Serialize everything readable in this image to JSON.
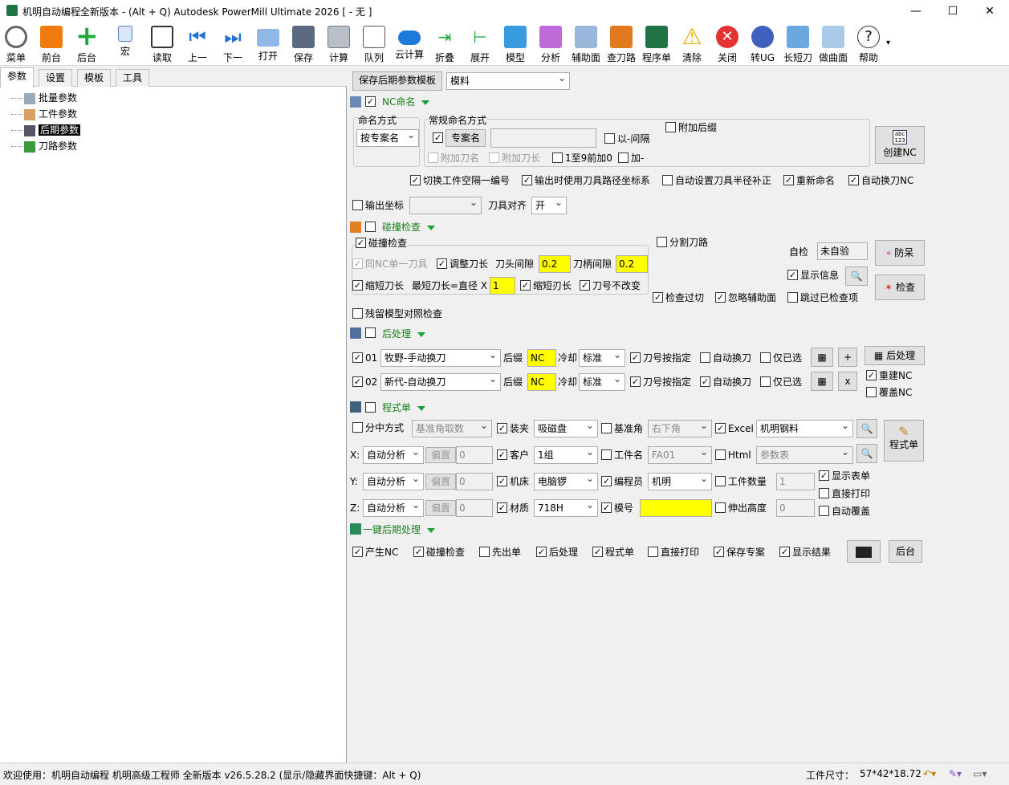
{
  "window": {
    "title": "机明自动编程全新版本 - (Alt + Q) Autodesk PowerMill Ultimate 2026    [ - 无 ]",
    "min": "—",
    "max": "☐",
    "close": "✕"
  },
  "toolbar": [
    {
      "label": "菜单",
      "icon": "gear-icon"
    },
    {
      "label": "前台",
      "icon": "powermill-icon"
    },
    {
      "label": "后台",
      "icon": "plus-icon"
    },
    {
      "label": "宏",
      "icon": "macro-icon"
    },
    {
      "label": "读取",
      "icon": "sliders-icon"
    },
    {
      "label": "上一",
      "icon": "skip-back-icon"
    },
    {
      "label": "下一",
      "icon": "skip-forward-icon"
    },
    {
      "label": "打开",
      "icon": "folder-icon"
    },
    {
      "label": "保存",
      "icon": "save-icon"
    },
    {
      "label": "计算",
      "icon": "calculator-icon"
    },
    {
      "label": "队列",
      "icon": "terminal-icon"
    },
    {
      "label": "云计算",
      "icon": "cloud-icon"
    },
    {
      "label": "折叠",
      "icon": "collapse-icon"
    },
    {
      "label": "展开",
      "icon": "expand-icon"
    },
    {
      "label": "模型",
      "icon": "cube-icon"
    },
    {
      "label": "分析",
      "icon": "analysis-icon"
    },
    {
      "label": "辅助面",
      "icon": "surface-icon"
    },
    {
      "label": "查刀路",
      "icon": "tools-icon"
    },
    {
      "label": "程序单",
      "icon": "excel-icon"
    },
    {
      "label": "清除",
      "icon": "warning-icon"
    },
    {
      "label": "关闭",
      "icon": "close-circle-icon"
    },
    {
      "label": "转UG",
      "icon": "ug-icon"
    },
    {
      "label": "长短刀",
      "icon": "tool-length-icon"
    },
    {
      "label": "做曲面",
      "icon": "surface-box-icon"
    },
    {
      "label": "帮助",
      "icon": "help-icon"
    }
  ],
  "left": {
    "tabs": [
      "参数",
      "设置",
      "模板",
      "工具"
    ],
    "tree": [
      "批量参数",
      "工件参数",
      "后期参数",
      "刀路参数"
    ]
  },
  "right": {
    "save_template": "保存后期参数模板",
    "template_value": "模料",
    "nc": {
      "section": "NC命名",
      "naming_mode_label": "命名方式",
      "naming_mode_value": "按专案名",
      "common_label": "常规命名方式",
      "project_name": "专案名",
      "with_gap": "以-间隔",
      "add_suffix": "附加后缀",
      "add_tool_name": "附加刀名",
      "add_tool_length": "附加刀长",
      "pad_zero": "1至9前加0",
      "plus_dash": "加-",
      "create_nc": "创建NC",
      "switch_ws": "切换工件空隔一编号",
      "use_coord": "输出时使用刀具路径坐标系",
      "auto_radius": "自动设置刀具半径补正",
      "rename": "重新命名",
      "auto_tool_nc": "自动换刀NC",
      "output_coord": "输出坐标",
      "tool_align": "刀具对齐",
      "tool_align_value": "开"
    },
    "collision": {
      "section": "碰撞检查",
      "group": "碰撞检查",
      "same_nc": "同NC单一刀具",
      "adjust_len": "调整刀长",
      "head_gap": "刀头间隙",
      "head_gap_value": "0.2",
      "holder_gap": "刀柄间隙",
      "holder_gap_value": "0.2",
      "shorten": "缩短刀长",
      "min_len": "最短刀长=直径  X",
      "min_len_value": "1",
      "shorten2": "缩短刃长",
      "tool_no_change": "刀号不改变",
      "split": "分割刀路",
      "self_check": "自检",
      "self_check_value": "未自验",
      "anti_dumb": "防呆",
      "show_info": "显示信息",
      "check": "检查",
      "check_cut": "检查过切",
      "ignore_aux": "忽略辅助面",
      "skip_checked": "跳过已检查项",
      "residual": "残留模型对照检查"
    },
    "post": {
      "section": "后处理",
      "rows": [
        {
          "no": "01",
          "machine": "牧野-手动换刀",
          "suffix_label": "后缀",
          "suffix": "NC",
          "cool_label": "冷却",
          "cool": "标准",
          "spec": "刀号按指定",
          "auto": "自动换刀",
          "only_sel": "仅已选",
          "act": "+"
        },
        {
          "no": "02",
          "machine": "新代-自动换刀",
          "suffix_label": "后缀",
          "suffix": "NC",
          "cool_label": "冷却",
          "cool": "标准",
          "spec": "刀号按指定",
          "auto": "自动换刀",
          "only_sel": "仅已选",
          "act": "x"
        }
      ],
      "btn": "后处理",
      "rebuild": "重建NC",
      "overwrite": "覆盖NC"
    },
    "sheet": {
      "section": "程式单",
      "split_mode": "分中方式",
      "split_value": "基准角取数",
      "clamp": "装夹",
      "clamp_value": "吸磁盘",
      "datum": "基准角",
      "datum_value": "右下角",
      "excel": "Excel",
      "excel_value": "机明钢料",
      "program_sheet": "程式单",
      "x": "X:",
      "x_mode": "自动分析",
      "offset": "偏置",
      "x_offset": "0",
      "customer": "客户",
      "customer_value": "1组",
      "part_name": "工件名",
      "part_name_value": "FA01",
      "html": "Html",
      "html_value": "参数表",
      "y": "Y:",
      "y_mode": "自动分析",
      "y_offset": "0",
      "machine": "机床",
      "machine_value": "电脑锣",
      "programmer": "编程员",
      "programmer_value": "机明",
      "part_count": "工件数量",
      "part_count_value": "1",
      "show_sheet": "显示表单",
      "direct_print": "直接打印",
      "z": "Z:",
      "z_mode": "自动分析",
      "z_offset": "0",
      "material": "材质",
      "material_value": "718H",
      "mold_no": "模号",
      "mold_no_value": "",
      "stick_out": "伸出高度",
      "stick_out_value": "0",
      "auto_overwrite": "自动覆盖"
    },
    "onekey": {
      "section": "一键后期处理",
      "gen_nc": "产生NC",
      "collision": "碰撞检查",
      "first_sheet": "先出单",
      "post": "后处理",
      "program_sheet": "程式单",
      "direct_print": "直接打印",
      "save_project": "保存专案",
      "show_result": "显示结果",
      "background": "后台"
    }
  },
  "status": {
    "welcome": "欢迎使用：机明自动编程  机明高级工程师  全新版本 v26.5.28.2   (显示/隐藏界面快捷键：Alt + Q)",
    "size_label": "工件尺寸：",
    "size_value": "57*42*18.72"
  }
}
